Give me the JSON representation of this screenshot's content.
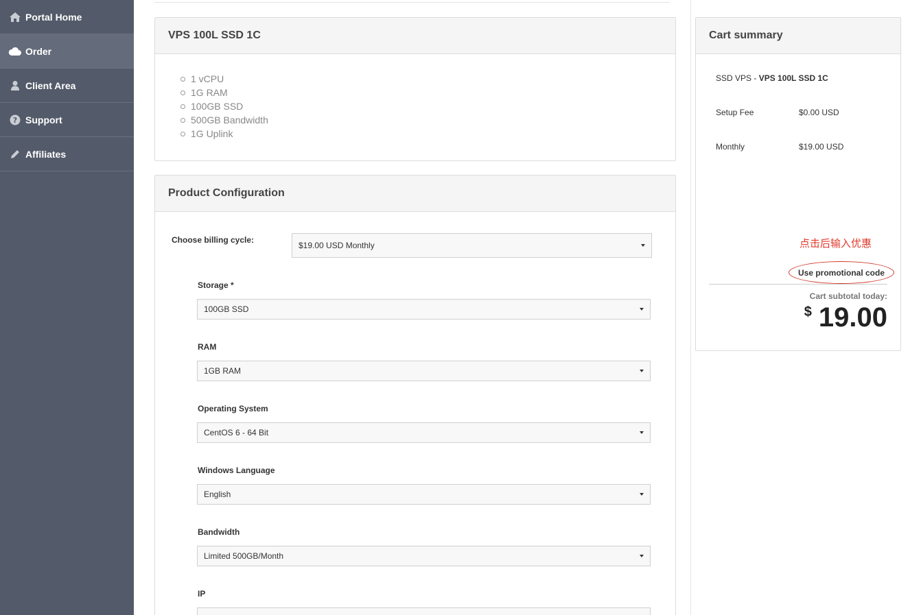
{
  "sidebar": {
    "items": [
      {
        "label": "Portal Home",
        "icon": "home-icon"
      },
      {
        "label": "Order",
        "icon": "cloud-icon"
      },
      {
        "label": "Client Area",
        "icon": "user-icon"
      },
      {
        "label": "Support",
        "icon": "question-icon"
      },
      {
        "label": "Affiliates",
        "icon": "pencil-icon"
      }
    ],
    "active": "Order"
  },
  "product": {
    "title": "VPS 100L SSD 1C",
    "features": [
      "1 vCPU",
      "1G RAM",
      "100GB SSD",
      "500GB Bandwidth",
      "1G Uplink"
    ]
  },
  "config": {
    "title": "Product Configuration",
    "billing_label": "Choose billing cycle:",
    "billing_value": "$19.00 USD Monthly",
    "storage_label": "Storage *",
    "storage_value": "100GB SSD",
    "ram_label": "RAM",
    "ram_value": "1GB RAM",
    "os_label": "Operating System",
    "os_value": "CentOS 6 - 64 Bit",
    "lang_label": "Windows Language",
    "lang_value": "English",
    "bandwidth_label": "Bandwidth",
    "bandwidth_value": "Limited 500GB/Month",
    "ip_label": "IP",
    "ip_value": ""
  },
  "cart": {
    "title": "Cart summary",
    "item_group": "SSD VPS - ",
    "item_name": "VPS 100L SSD 1C",
    "setup_label": "Setup Fee",
    "setup_value": "$0.00 USD",
    "monthly_label": "Monthly",
    "monthly_value": "$19.00 USD",
    "annotation": "点击后输入优惠",
    "promo_label": "Use promotional code",
    "subtotal_label": "Cart subtotal today:",
    "currency": "$",
    "subtotal": "19.00"
  },
  "colors": {
    "sidebar_bg": "#535a69",
    "annotation_red": "#e03b2d"
  }
}
